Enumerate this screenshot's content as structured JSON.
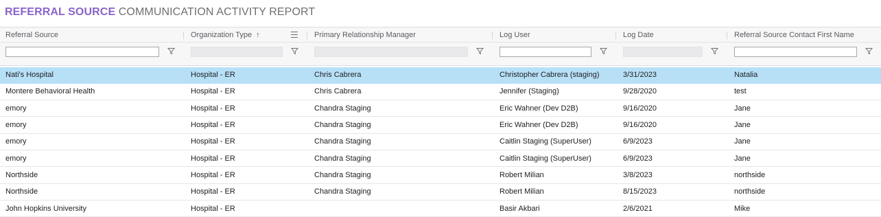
{
  "report_title": {
    "strong": "REFERRAL SOURCE",
    "rest": "COMMUNICATION ACTIVITY REPORT"
  },
  "colors": {
    "accent": "#8a63c9",
    "selected_row": "#b7e0f7"
  },
  "columns": [
    {
      "label": "Referral Source",
      "filter_enabled": true,
      "filter_value": ""
    },
    {
      "label": "Organization Type",
      "sort": "ascending",
      "sort_icon": "arrow-up-icon",
      "menu_icon": "column-menu-icon",
      "filter_enabled": false,
      "filter_value": ""
    },
    {
      "label": "Primary Relationship Manager",
      "filter_enabled": false,
      "filter_value": ""
    },
    {
      "label": "Log User",
      "filter_enabled": true,
      "filter_value": ""
    },
    {
      "label": "Log Date",
      "filter_enabled": false,
      "filter_value": ""
    },
    {
      "label": "Referral Source Contact First Name",
      "filter_enabled": true,
      "filter_value": ""
    }
  ],
  "sort_arrow": "↑",
  "rows": [
    {
      "selected": true,
      "cells": [
        "Nati's Hospital",
        "Hospital - ER",
        "Chris Cabrera",
        "Christopher Cabrera (staging)",
        "3/31/2023",
        "Natalia"
      ]
    },
    {
      "selected": false,
      "cells": [
        "Montere Behavioral Health",
        "Hospital - ER",
        "Chris Cabrera",
        "Jennifer (Staging)",
        "9/28/2020",
        "test"
      ]
    },
    {
      "selected": false,
      "cells": [
        "emory",
        "Hospital - ER",
        "Chandra Staging",
        "Eric Wahner (Dev D2B)",
        "9/16/2020",
        "Jane"
      ]
    },
    {
      "selected": false,
      "cells": [
        "emory",
        "Hospital - ER",
        "Chandra Staging",
        "Eric Wahner (Dev D2B)",
        "9/16/2020",
        "Jane"
      ]
    },
    {
      "selected": false,
      "cells": [
        "emory",
        "Hospital - ER",
        "Chandra Staging",
        "Caitlin Staging (SuperUser)",
        "6/9/2023",
        "Jane"
      ]
    },
    {
      "selected": false,
      "cells": [
        "emory",
        "Hospital - ER",
        "Chandra Staging",
        "Caitlin Staging (SuperUser)",
        "6/9/2023",
        "Jane"
      ]
    },
    {
      "selected": false,
      "cells": [
        "Northside",
        "Hospital - ER",
        "Chandra Staging",
        "Robert Milian",
        "3/8/2023",
        "northside"
      ]
    },
    {
      "selected": false,
      "cells": [
        "Northside",
        "Hospital - ER",
        "Chandra Staging",
        "Robert Milian",
        "8/15/2023",
        "northside"
      ]
    },
    {
      "selected": false,
      "cells": [
        "John Hopkins University",
        "Hospital - ER",
        "",
        "Basir Akbari",
        "2/6/2021",
        "Mike"
      ]
    }
  ]
}
